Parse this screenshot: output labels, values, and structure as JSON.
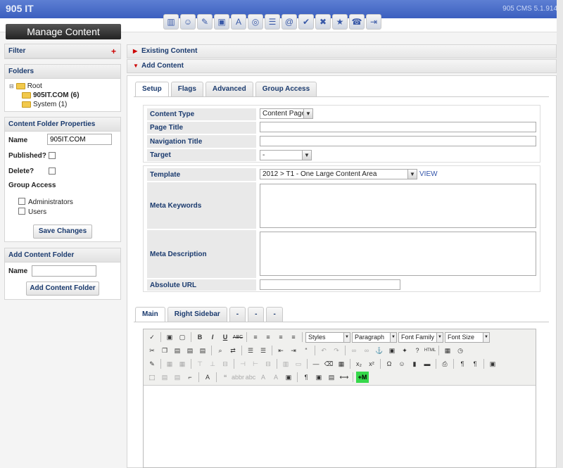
{
  "app": {
    "brand": "905 IT",
    "version": "905 CMS 5.1.914"
  },
  "toolbar_icons": [
    "chart-icon",
    "users-icon",
    "edit-icon",
    "image-add-icon",
    "text-add-icon",
    "database-icon",
    "list-icon",
    "email-icon",
    "checklist-icon",
    "tools-icon",
    "folder-star-icon",
    "phone-icon",
    "exit-icon"
  ],
  "sidebar": {
    "title": "Manage Content",
    "filter": {
      "header": "Filter",
      "add_symbol": "+"
    },
    "folders": {
      "header": "Folders",
      "root": "Root",
      "children": [
        {
          "label": "905IT.COM (6)"
        },
        {
          "label": "System (1)"
        }
      ]
    },
    "props": {
      "header": "Content Folder Properties",
      "name_label": "Name",
      "name_value": "905IT.COM",
      "published_label": "Published?",
      "delete_label": "Delete?",
      "group_access_label": "Group Access",
      "groups": [
        "Administrators",
        "Users"
      ],
      "save_label": "Save Changes"
    },
    "add_folder": {
      "header": "Add Content Folder",
      "name_label": "Name",
      "name_value": "",
      "button_label": "Add Content Folder"
    }
  },
  "main": {
    "existing_label": "Existing Content",
    "add_label": "Add Content",
    "tabs": [
      "Setup",
      "Flags",
      "Advanced",
      "Group Access"
    ],
    "fields": {
      "content_type_label": "Content Type",
      "content_type_value": "Content Page",
      "page_title_label": "Page Title",
      "nav_title_label": "Navigation Title",
      "target_label": "Target",
      "target_value": "-",
      "template_label": "Template",
      "template_value": "2012 > T1 - One Large Content Area",
      "view_link": "VIEW",
      "meta_keywords_label": "Meta Keywords",
      "meta_description_label": "Meta Description",
      "absolute_url_label": "Absolute URL"
    },
    "editor_tabs": [
      "Main",
      "Right Sidebar",
      "-",
      "-",
      "-"
    ],
    "editor": {
      "styles": "Styles",
      "paragraph": "Paragraph",
      "font_family": "Font Family",
      "font_size": "Font Size",
      "insert_module_label": "+M"
    }
  }
}
